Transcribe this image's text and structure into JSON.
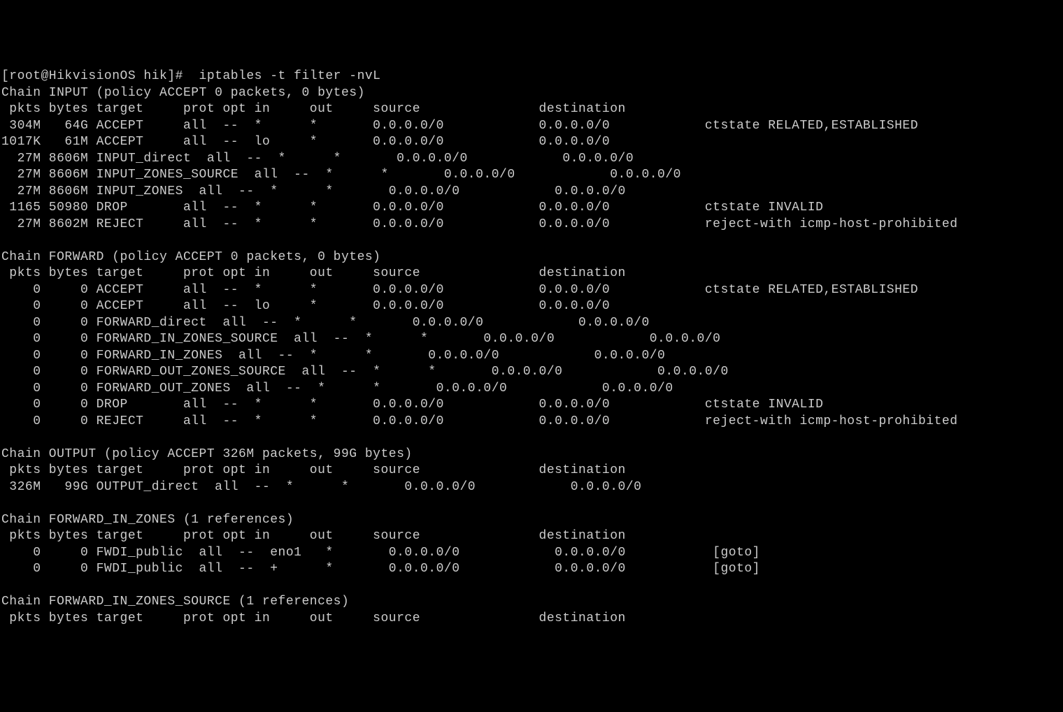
{
  "prompt": "[root@HikvisionOS hik]#  iptables -t filter -nvL",
  "chains": [
    {
      "name": "INPUT",
      "header": "Chain INPUT (policy ACCEPT 0 packets, 0 bytes)",
      "cols": " pkts bytes target     prot opt in     out     source               destination         ",
      "rules": [
        " 304M   64G ACCEPT     all  --  *      *       0.0.0.0/0            0.0.0.0/0            ctstate RELATED,ESTABLISHED",
        "1017K   61M ACCEPT     all  --  lo     *       0.0.0.0/0            0.0.0.0/0           ",
        "  27M 8606M INPUT_direct  all  --  *      *       0.0.0.0/0            0.0.0.0/0           ",
        "  27M 8606M INPUT_ZONES_SOURCE  all  --  *      *       0.0.0.0/0            0.0.0.0/0           ",
        "  27M 8606M INPUT_ZONES  all  --  *      *       0.0.0.0/0            0.0.0.0/0           ",
        " 1165 50980 DROP       all  --  *      *       0.0.0.0/0            0.0.0.0/0            ctstate INVALID",
        "  27M 8602M REJECT     all  --  *      *       0.0.0.0/0            0.0.0.0/0            reject-with icmp-host-prohibited"
      ]
    },
    {
      "name": "FORWARD",
      "header": "Chain FORWARD (policy ACCEPT 0 packets, 0 bytes)",
      "cols": " pkts bytes target     prot opt in     out     source               destination         ",
      "rules": [
        "    0     0 ACCEPT     all  --  *      *       0.0.0.0/0            0.0.0.0/0            ctstate RELATED,ESTABLISHED",
        "    0     0 ACCEPT     all  --  lo     *       0.0.0.0/0            0.0.0.0/0           ",
        "    0     0 FORWARD_direct  all  --  *      *       0.0.0.0/0            0.0.0.0/0           ",
        "    0     0 FORWARD_IN_ZONES_SOURCE  all  --  *      *       0.0.0.0/0            0.0.0.0/0           ",
        "    0     0 FORWARD_IN_ZONES  all  --  *      *       0.0.0.0/0            0.0.0.0/0           ",
        "    0     0 FORWARD_OUT_ZONES_SOURCE  all  --  *      *       0.0.0.0/0            0.0.0.0/0           ",
        "    0     0 FORWARD_OUT_ZONES  all  --  *      *       0.0.0.0/0            0.0.0.0/0           ",
        "    0     0 DROP       all  --  *      *       0.0.0.0/0            0.0.0.0/0            ctstate INVALID",
        "    0     0 REJECT     all  --  *      *       0.0.0.0/0            0.0.0.0/0            reject-with icmp-host-prohibited"
      ]
    },
    {
      "name": "OUTPUT",
      "header": "Chain OUTPUT (policy ACCEPT 326M packets, 99G bytes)",
      "cols": " pkts bytes target     prot opt in     out     source               destination         ",
      "rules": [
        " 326M   99G OUTPUT_direct  all  --  *      *       0.0.0.0/0            0.0.0.0/0           "
      ]
    },
    {
      "name": "FORWARD_IN_ZONES",
      "header": "Chain FORWARD_IN_ZONES (1 references)",
      "cols": " pkts bytes target     prot opt in     out     source               destination         ",
      "rules": [
        "    0     0 FWDI_public  all  --  eno1   *       0.0.0.0/0            0.0.0.0/0           [goto] ",
        "    0     0 FWDI_public  all  --  +      *       0.0.0.0/0            0.0.0.0/0           [goto] "
      ]
    },
    {
      "name": "FORWARD_IN_ZONES_SOURCE",
      "header": "Chain FORWARD_IN_ZONES_SOURCE (1 references)",
      "cols": " pkts bytes target     prot opt in     out     source               destination         ",
      "rules": []
    }
  ]
}
